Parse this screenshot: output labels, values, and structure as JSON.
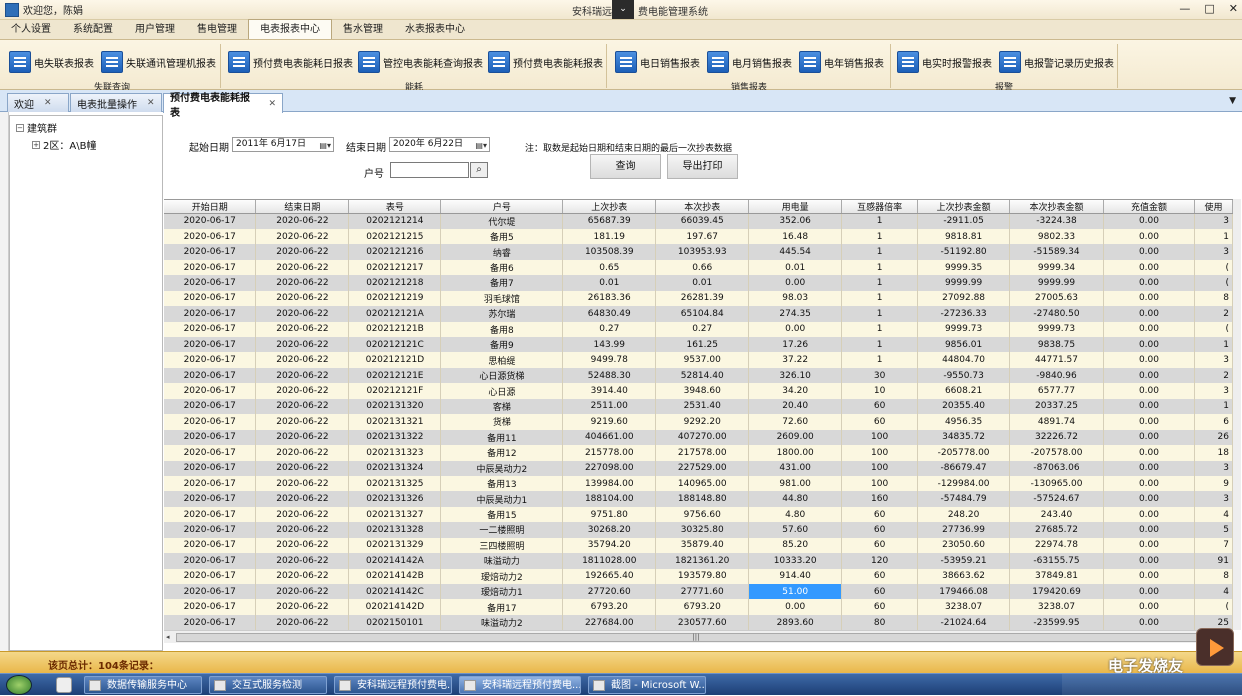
{
  "window": {
    "welcome": "欢迎您，陈娟",
    "title_left": "安科瑞远",
    "title_right": "费电能管理系统",
    "min": "—",
    "max": "□",
    "close": "✕"
  },
  "menu": [
    "个人设置",
    "系统配置",
    "用户管理",
    "售电管理",
    "电表报表中心",
    "售水管理",
    "水表报表中心"
  ],
  "ribbon": {
    "buttons": [
      "电失联表报表",
      "失联通讯管理机报表",
      "预付费电表能耗日报表",
      "管控电表能耗查询报表",
      "预付费电表能耗报表",
      "电日销售报表",
      "电月销售报表",
      "电年销售报表",
      "电实时报警报表",
      "电报警记录历史报表"
    ],
    "groups": [
      "失联查询",
      "能耗",
      "销售报表",
      "报警"
    ]
  },
  "tabs": [
    "欢迎",
    "电表批量操作",
    "预付费电表能耗报表"
  ],
  "tree": {
    "root": "建筑群",
    "child": "2区：A\\B幢"
  },
  "form": {
    "start_label": "起始日期",
    "start_value": "2011年  6月17日",
    "end_label": "结束日期",
    "end_value": "2020年  6月22日",
    "note": "注：取数是起始日期和结束日期的最后一次抄表数据",
    "household_label": "户号",
    "query_btn": "查询",
    "export_btn": "导出打印"
  },
  "table": {
    "columns": [
      "开始日期",
      "结束日期",
      "表号",
      "户号",
      "上次抄表",
      "本次抄表",
      "用电量",
      "互感器倍率",
      "上次抄表金额",
      "本次抄表金额",
      "充值金额",
      "使用"
    ],
    "rows": [
      [
        "2020-06-17",
        "2020-06-22",
        "0202121214",
        "代尔堤",
        "65687.39",
        "66039.45",
        "352.06",
        "1",
        "-2911.05",
        "-3224.38",
        "0.00",
        "3"
      ],
      [
        "2020-06-17",
        "2020-06-22",
        "0202121215",
        "备用5",
        "181.19",
        "197.67",
        "16.48",
        "1",
        "9818.81",
        "9802.33",
        "0.00",
        "1"
      ],
      [
        "2020-06-17",
        "2020-06-22",
        "0202121216",
        "纳睿",
        "103508.39",
        "103953.93",
        "445.54",
        "1",
        "-51192.80",
        "-51589.34",
        "0.00",
        "3"
      ],
      [
        "2020-06-17",
        "2020-06-22",
        "0202121217",
        "备用6",
        "0.65",
        "0.66",
        "0.01",
        "1",
        "9999.35",
        "9999.34",
        "0.00",
        "("
      ],
      [
        "2020-06-17",
        "2020-06-22",
        "0202121218",
        "备用7",
        "0.01",
        "0.01",
        "0.00",
        "1",
        "9999.99",
        "9999.99",
        "0.00",
        "("
      ],
      [
        "2020-06-17",
        "2020-06-22",
        "0202121219",
        "羽毛球馆",
        "26183.36",
        "26281.39",
        "98.03",
        "1",
        "27092.88",
        "27005.63",
        "0.00",
        "8"
      ],
      [
        "2020-06-17",
        "2020-06-22",
        "020212121A",
        "苏尔瑞",
        "64830.49",
        "65104.84",
        "274.35",
        "1",
        "-27236.33",
        "-27480.50",
        "0.00",
        "2"
      ],
      [
        "2020-06-17",
        "2020-06-22",
        "020212121B",
        "备用8",
        "0.27",
        "0.27",
        "0.00",
        "1",
        "9999.73",
        "9999.73",
        "0.00",
        "("
      ],
      [
        "2020-06-17",
        "2020-06-22",
        "020212121C",
        "备用9",
        "143.99",
        "161.25",
        "17.26",
        "1",
        "9856.01",
        "9838.75",
        "0.00",
        "1"
      ],
      [
        "2020-06-17",
        "2020-06-22",
        "020212121D",
        "思柏缇",
        "9499.78",
        "9537.00",
        "37.22",
        "1",
        "44804.70",
        "44771.57",
        "0.00",
        "3"
      ],
      [
        "2020-06-17",
        "2020-06-22",
        "020212121E",
        "心日源货梯",
        "52488.30",
        "52814.40",
        "326.10",
        "30",
        "-9550.73",
        "-9840.96",
        "0.00",
        "2"
      ],
      [
        "2020-06-17",
        "2020-06-22",
        "020212121F",
        "心日源",
        "3914.40",
        "3948.60",
        "34.20",
        "10",
        "6608.21",
        "6577.77",
        "0.00",
        "3"
      ],
      [
        "2020-06-17",
        "2020-06-22",
        "0202131320",
        "客梯",
        "2511.00",
        "2531.40",
        "20.40",
        "60",
        "20355.40",
        "20337.25",
        "0.00",
        "1"
      ],
      [
        "2020-06-17",
        "2020-06-22",
        "0202131321",
        "货梯",
        "9219.60",
        "9292.20",
        "72.60",
        "60",
        "4956.35",
        "4891.74",
        "0.00",
        "6"
      ],
      [
        "2020-06-17",
        "2020-06-22",
        "0202131322",
        "备用11",
        "404661.00",
        "407270.00",
        "2609.00",
        "100",
        "34835.72",
        "32226.72",
        "0.00",
        "26"
      ],
      [
        "2020-06-17",
        "2020-06-22",
        "0202131323",
        "备用12",
        "215778.00",
        "217578.00",
        "1800.00",
        "100",
        "-205778.00",
        "-207578.00",
        "0.00",
        "18"
      ],
      [
        "2020-06-17",
        "2020-06-22",
        "0202131324",
        "中辰昊动力2",
        "227098.00",
        "227529.00",
        "431.00",
        "100",
        "-86679.47",
        "-87063.06",
        "0.00",
        "3"
      ],
      [
        "2020-06-17",
        "2020-06-22",
        "0202131325",
        "备用13",
        "139984.00",
        "140965.00",
        "981.00",
        "100",
        "-129984.00",
        "-130965.00",
        "0.00",
        "9"
      ],
      [
        "2020-06-17",
        "2020-06-22",
        "0202131326",
        "中辰昊动力1",
        "188104.00",
        "188148.80",
        "44.80",
        "160",
        "-57484.79",
        "-57524.67",
        "0.00",
        "3"
      ],
      [
        "2020-06-17",
        "2020-06-22",
        "0202131327",
        "备用15",
        "9751.80",
        "9756.60",
        "4.80",
        "60",
        "248.20",
        "243.40",
        "0.00",
        "4"
      ],
      [
        "2020-06-17",
        "2020-06-22",
        "0202131328",
        "一二楼照明",
        "30268.20",
        "30325.80",
        "57.60",
        "60",
        "27736.99",
        "27685.72",
        "0.00",
        "5"
      ],
      [
        "2020-06-17",
        "2020-06-22",
        "0202131329",
        "三四楼照明",
        "35794.20",
        "35879.40",
        "85.20",
        "60",
        "23050.60",
        "22974.78",
        "0.00",
        "7"
      ],
      [
        "2020-06-17",
        "2020-06-22",
        "020214142A",
        "味溢动力",
        "1811028.00",
        "1821361.20",
        "10333.20",
        "120",
        "-53959.21",
        "-63155.75",
        "0.00",
        "91"
      ],
      [
        "2020-06-17",
        "2020-06-22",
        "020214142B",
        "瑷焙动力2",
        "192665.40",
        "193579.80",
        "914.40",
        "60",
        "38663.62",
        "37849.81",
        "0.00",
        "8"
      ],
      [
        "2020-06-17",
        "2020-06-22",
        "020214142C",
        "瑷焙动力1",
        "27720.60",
        "27771.60",
        "51.00",
        "60",
        "179466.08",
        "179420.69",
        "0.00",
        "4"
      ],
      [
        "2020-06-17",
        "2020-06-22",
        "020214142D",
        "备用17",
        "6793.20",
        "6793.20",
        "0.00",
        "60",
        "3238.07",
        "3238.07",
        "0.00",
        "("
      ],
      [
        "2020-06-17",
        "2020-06-22",
        "0202150101",
        "味溢动力2",
        "227684.00",
        "230577.60",
        "2893.60",
        "80",
        "-21024.64",
        "-23599.95",
        "0.00",
        "25"
      ]
    ]
  },
  "summary": "该页总计：104条记录：",
  "taskbar": {
    "items": [
      "数据传输服务中心",
      "交互式服务检测",
      "安科瑞远程预付费电...",
      "安科瑞远程预付费电...",
      "截图 - Microsoft W..."
    ]
  },
  "watermark": "电子发烧友"
}
